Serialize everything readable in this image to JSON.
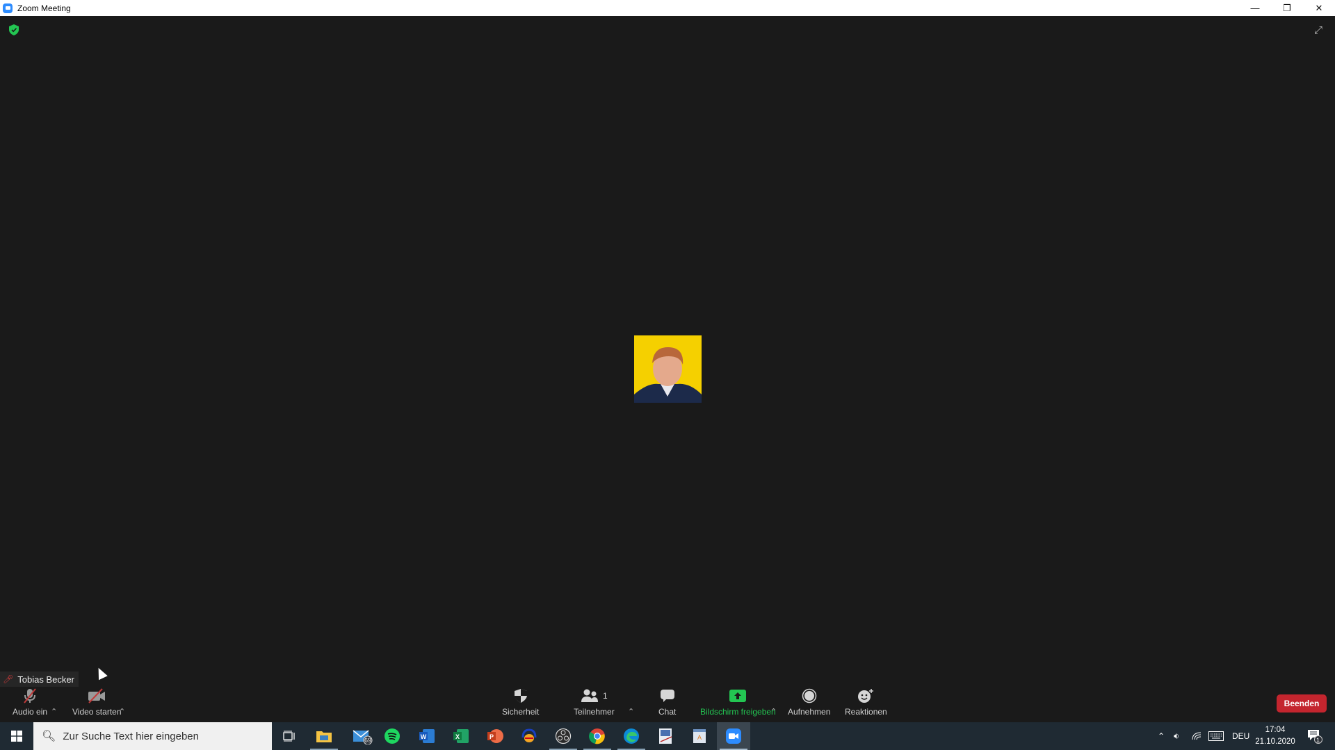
{
  "window": {
    "title": "Zoom Meeting",
    "controls": [
      "minimize",
      "restore",
      "close"
    ]
  },
  "meeting": {
    "encryption_icon": "shield-check-icon",
    "fullscreen_icon": "expand-icon",
    "participant_name": "Tobias Becker",
    "participant_muted": true
  },
  "toolbar": {
    "audio_label": "Audio ein",
    "video_label": "Video starten",
    "security_label": "Sicherheit",
    "participants_label": "Teilnehmer",
    "participants_count": "1",
    "chat_label": "Chat",
    "share_label": "Bildschirm freigeben",
    "record_label": "Aufnehmen",
    "reactions_label": "Reaktionen",
    "end_label": "Beenden"
  },
  "colors": {
    "share_green": "#23c552",
    "end_red": "#c4252e",
    "avatar_bg": "#f5d000"
  },
  "taskbar": {
    "search_placeholder": "Zur Suche Text hier eingeben",
    "mail_badge": "69",
    "apps": [
      "task-view",
      "file-explorer",
      "mail",
      "spotify",
      "word",
      "excel",
      "powerpoint",
      "audacity",
      "obs",
      "chrome",
      "edge",
      "app-1",
      "app-2",
      "zoom"
    ],
    "tray": {
      "language": "DEU",
      "time": "17:04",
      "date": "21.10.2020",
      "notifications": "1"
    }
  }
}
